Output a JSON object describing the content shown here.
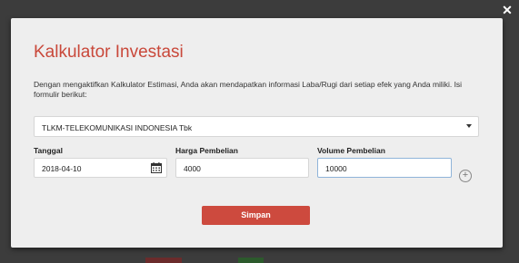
{
  "modal": {
    "close_icon": "close-icon",
    "title": "Kalkulator Investasi",
    "description": "Dengan mengaktifkan Kalkulator Estimasi, Anda akan mendapatkan informasi Laba/Rugi dari setiap efek yang Anda miliki. Isi formulir berikut:",
    "stock_select": {
      "selected": "TLKM-TELEKOMUNIKASI INDONESIA Tbk",
      "icon": "chevron-down-icon"
    },
    "fields": {
      "date": {
        "label": "Tanggal",
        "value": "2018-04-10",
        "icon": "calendar-icon"
      },
      "price": {
        "label": "Harga Pembelian",
        "value": "4000"
      },
      "volume": {
        "label": "Volume Pembelian",
        "value": "10000"
      }
    },
    "add_icon": "plus-circle-icon",
    "submit_label": "Simpan"
  },
  "colors": {
    "accent": "#c9483a",
    "button": "#cd4a3e",
    "modal_bg": "#eeeeee",
    "overlay": "#3c3c3c"
  }
}
